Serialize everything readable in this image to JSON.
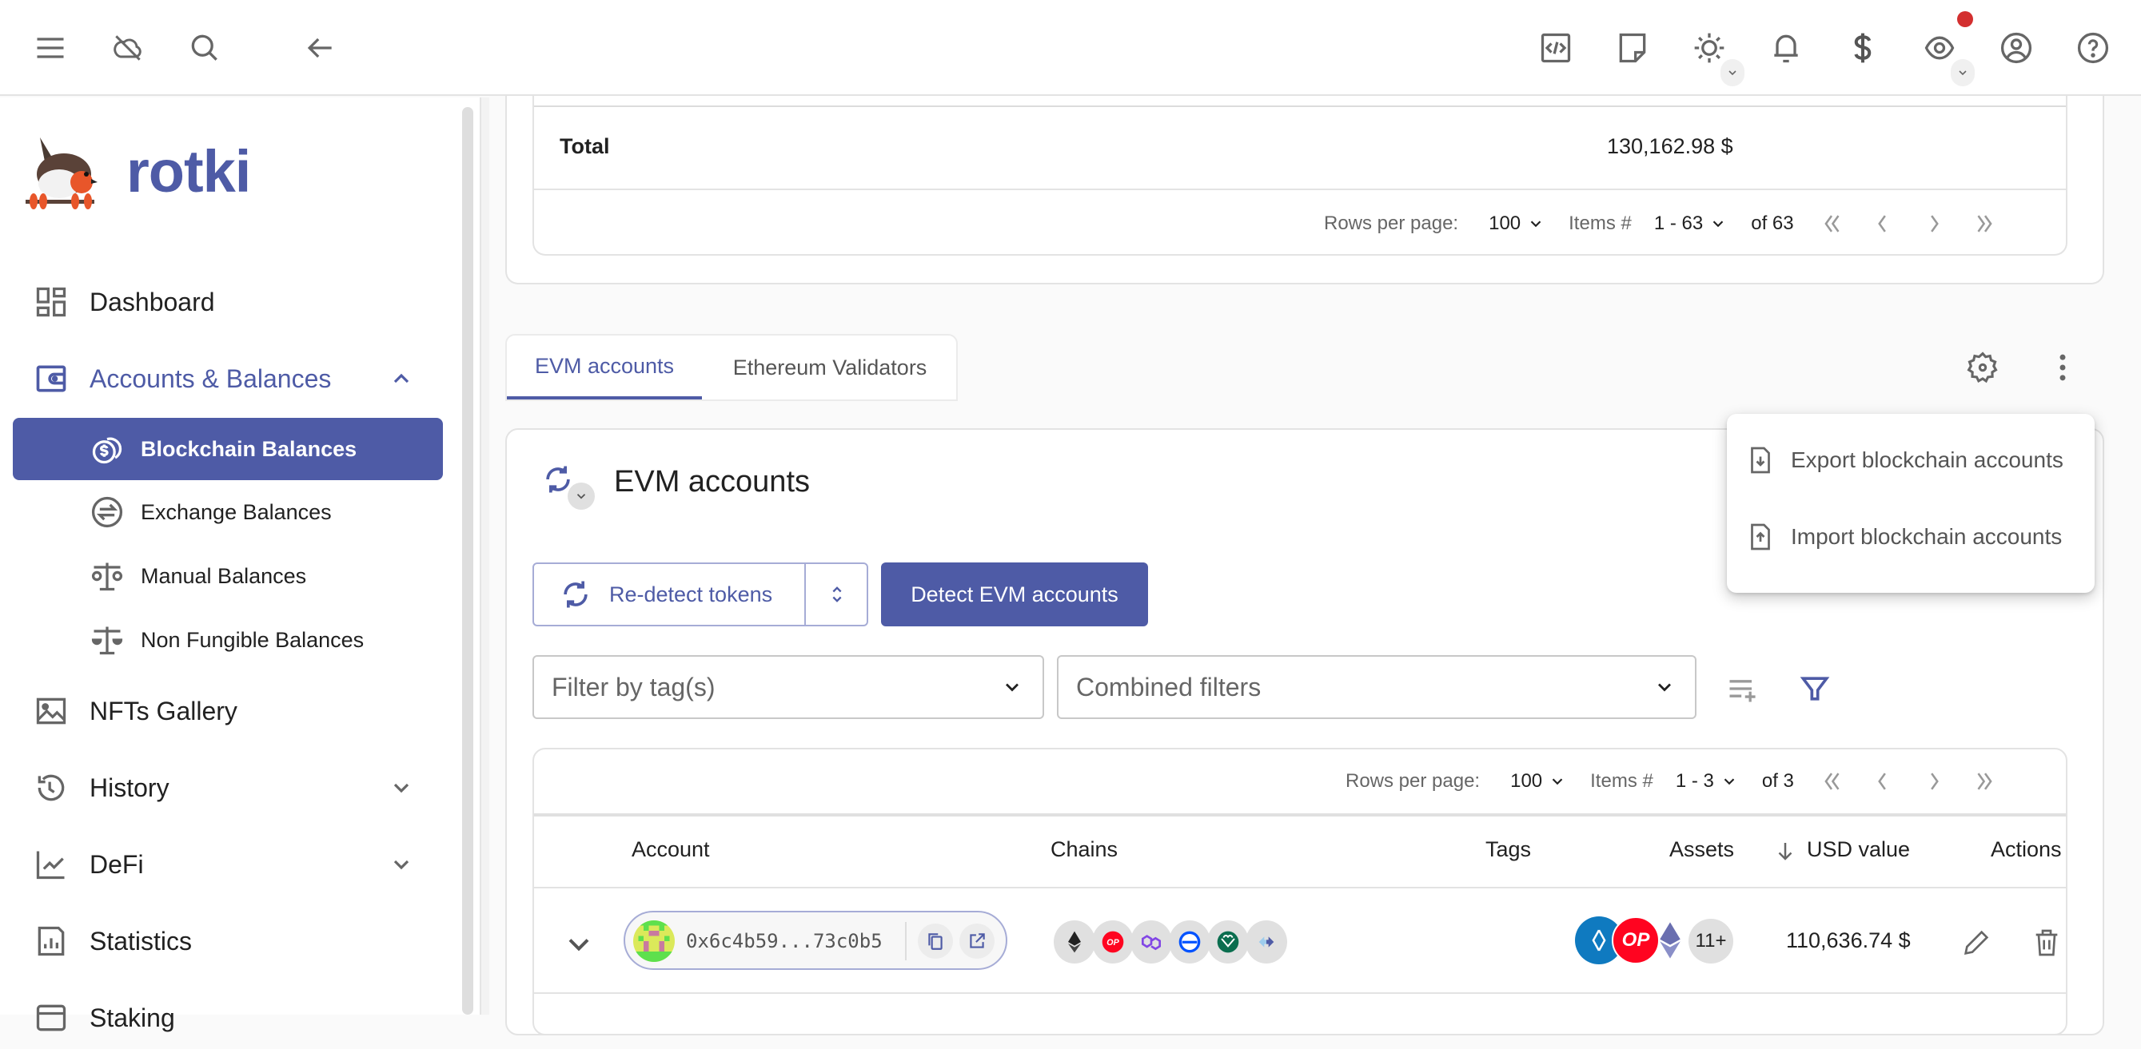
{
  "topbar": {
    "left_icons": [
      "menu-icon",
      "cloud-off-icon",
      "search-icon",
      "back-arrow-icon"
    ],
    "right_icons": [
      "code-icon",
      "notes-icon",
      "theme-sun-icon",
      "bell-icon",
      "currency-dollar-icon",
      "privacy-eye-icon",
      "account-icon",
      "help-icon"
    ],
    "notification_dot_color": "#d32f2f"
  },
  "sidebar": {
    "app_name": "rotki",
    "items": [
      {
        "label": "Dashboard",
        "icon": "dashboard-icon"
      },
      {
        "label": "Accounts & Balances",
        "icon": "wallet-icon",
        "expanded": true,
        "children": [
          {
            "label": "Blockchain Balances",
            "icon": "coins-icon",
            "active": true
          },
          {
            "label": "Exchange Balances",
            "icon": "exchange-icon"
          },
          {
            "label": "Manual Balances",
            "icon": "scale-icon"
          },
          {
            "label": "Non Fungible Balances",
            "icon": "scale-icon"
          }
        ]
      },
      {
        "label": "NFTs Gallery",
        "icon": "image-icon"
      },
      {
        "label": "History",
        "icon": "history-icon",
        "expandable": true
      },
      {
        "label": "DeFi",
        "icon": "chart-line-icon",
        "expandable": true
      },
      {
        "label": "Statistics",
        "icon": "bar-chart-icon"
      },
      {
        "label": "Staking",
        "icon": "staking-icon"
      }
    ]
  },
  "summary_table": {
    "total_label": "Total",
    "total_value": "130,162.98 $",
    "pagination": {
      "rows_per_page_label": "Rows per page:",
      "rows_per_page": "100",
      "items_label": "Items #",
      "items_range": "1 - 63",
      "of_label": "of 63"
    }
  },
  "tabs": [
    {
      "label": "EVM accounts",
      "active": true
    },
    {
      "label": "Ethereum Validators",
      "active": false
    }
  ],
  "menu": {
    "items": [
      {
        "label": "Export blockchain accounts",
        "icon": "file-export-icon"
      },
      {
        "label": "Import blockchain accounts",
        "icon": "file-import-icon"
      }
    ]
  },
  "evm_section": {
    "title": "EVM accounts",
    "redetect_label": "Re-detect tokens",
    "detect_label": "Detect EVM accounts",
    "filter_tags_placeholder": "Filter by tag(s)",
    "combined_filters_placeholder": "Combined filters",
    "pagination": {
      "rows_per_page_label": "Rows per page:",
      "rows_per_page": "100",
      "items_label": "Items #",
      "items_range": "1 - 3",
      "of_label": "of 3"
    },
    "columns": [
      "Account",
      "Chains",
      "Tags",
      "Assets",
      "USD value",
      "Actions"
    ],
    "sort_column": "USD value",
    "rows": [
      {
        "address": "0x6c4b59...73c0b5",
        "chains": [
          "ethereum",
          "optimism",
          "polygon",
          "base",
          "gnosis",
          "arbitrum"
        ],
        "tags": "",
        "assets_more": "11+",
        "usd_value": "110,636.74 $"
      }
    ]
  },
  "colors": {
    "accent": "#4e5ba6",
    "text": "#212121",
    "muted": "#666666",
    "border": "#e3e3e3"
  }
}
